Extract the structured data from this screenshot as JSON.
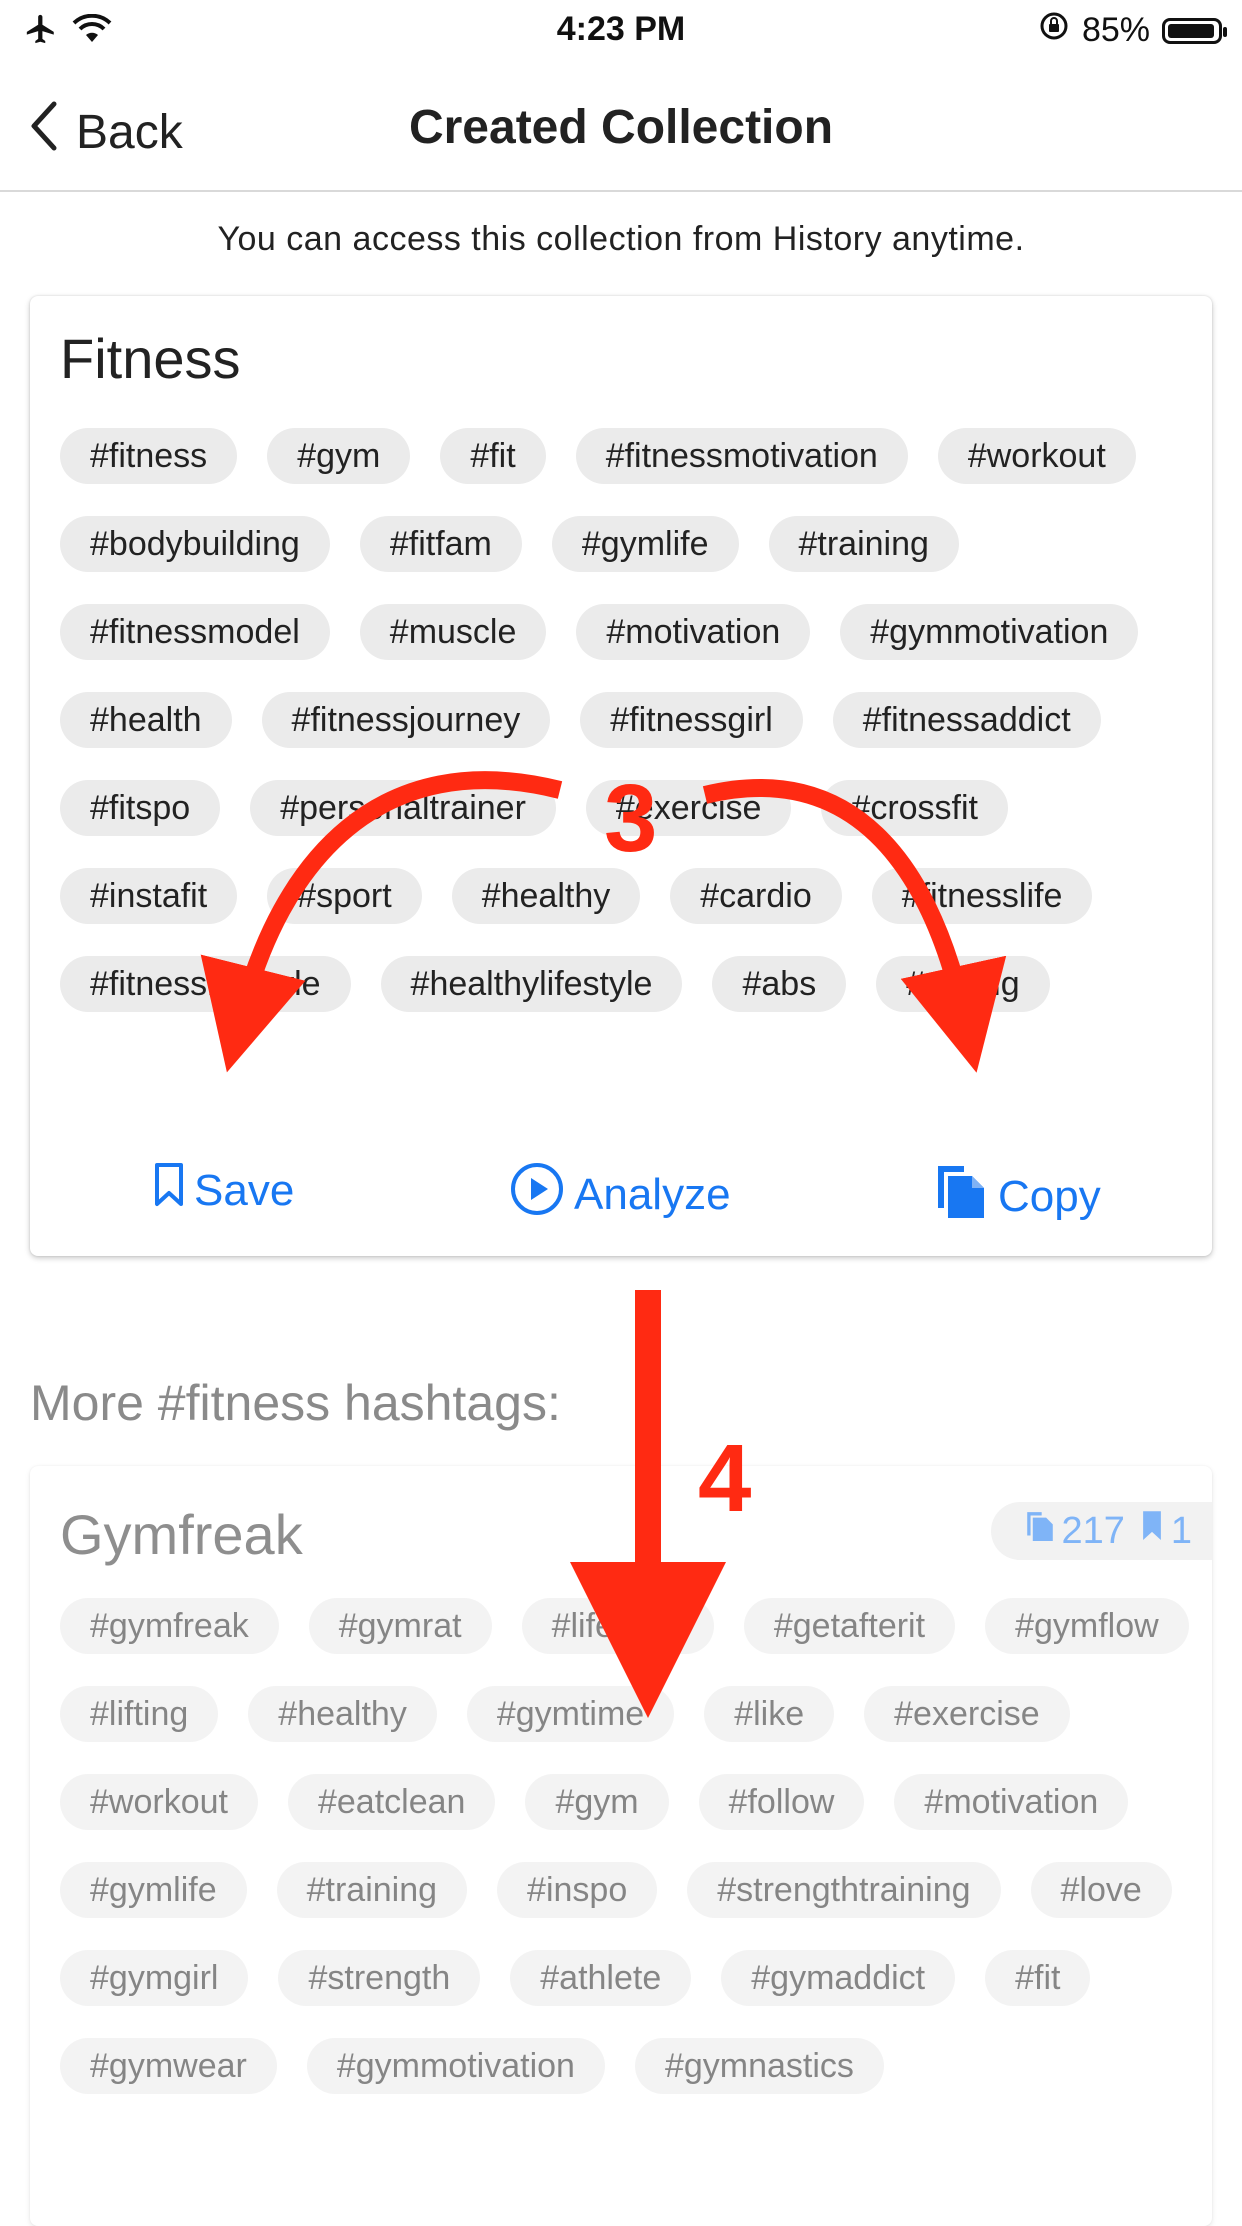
{
  "status_bar": {
    "time": "4:23 PM",
    "battery_percent": "85%",
    "icons": [
      "airplane-icon",
      "wifi-icon",
      "orientation-lock-icon",
      "battery-icon"
    ]
  },
  "nav": {
    "back_label": "Back",
    "title": "Created Collection"
  },
  "notice": "You can access this collection from History anytime.",
  "collection": {
    "title": "Fitness",
    "tags": [
      "#fitness",
      "#gym",
      "#fit",
      "#fitnessmotivation",
      "#workout",
      "#bodybuilding",
      "#fitfam",
      "#gymlife",
      "#training",
      "#fitnessmodel",
      "#muscle",
      "#motivation",
      "#gymmotivation",
      "#health",
      "#fitnessjourney",
      "#fitnessgirl",
      "#fitnessaddict",
      "#fitspo",
      "#personaltrainer",
      "#exercise",
      "#crossfit",
      "#instafit",
      "#sport",
      "#healthy",
      "#cardio",
      "#fitnesslife",
      "#fitnesslifestyle",
      "#healthylifestyle",
      "#abs",
      "#strong"
    ],
    "actions": {
      "save": "Save",
      "analyze": "Analyze",
      "copy": "Copy"
    }
  },
  "more_title": "More #fitness hashtags:",
  "more_collection": {
    "title": "Gymfreak",
    "copies": "217",
    "saves": "1",
    "tags": [
      "#gymfreak",
      "#gymrat",
      "#lifestyle",
      "#getafterit",
      "#gymflow",
      "#lifting",
      "#healthy",
      "#gymtime",
      "#like",
      "#exercise",
      "#workout",
      "#eatclean",
      "#gym",
      "#follow",
      "#motivation",
      "#gymlife",
      "#training",
      "#inspo",
      "#strengthtraining",
      "#love",
      "#gymgirl",
      "#strength",
      "#athlete",
      "#gymaddict",
      "#fit",
      "#gymwear",
      "#gymmotivation",
      "#gymnastics"
    ]
  },
  "annotations": {
    "step3": "3",
    "step4": "4",
    "color": "#ff2a12"
  },
  "accent_color": "#1877f2"
}
